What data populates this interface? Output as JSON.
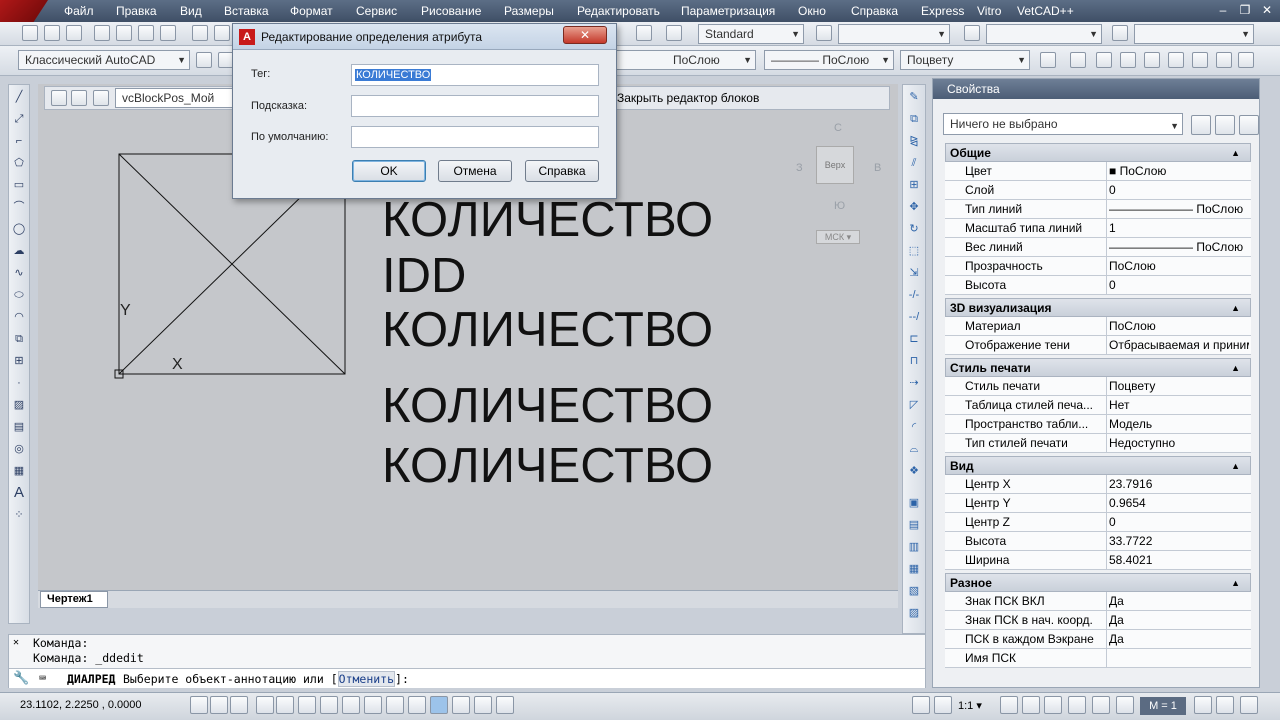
{
  "menu": {
    "items": [
      "Файл",
      "Правка",
      "Вид",
      "Вставка",
      "Формат",
      "Сервис",
      "Рисование",
      "Размеры",
      "Редактировать",
      "Параметризация",
      "Окно",
      "Справка",
      "Express",
      "Vitro",
      "VetCAD++"
    ]
  },
  "toolbar": {
    "workspace": "Классический AutoCAD",
    "text_style": "Standard",
    "linetype": "ПоСлою",
    "lineweight": "ПоСлою",
    "plotstyle": "Поцвету",
    "block_name": "vcBlockPos_Мой",
    "close_block_editor": "Закрыть редактор блоков"
  },
  "viewcube": {
    "north": "С",
    "south": "Ю",
    "west": "З",
    "east": "В",
    "face": "Верх",
    "ucs": "МСК"
  },
  "drawing": {
    "lines": [
      "КОЛИЧЕСТВО",
      "IDD",
      "КОЛИЧЕСТВО",
      "КОЛИЧЕСТВО",
      "КОЛИЧЕСТВО"
    ],
    "partial_top": "Я",
    "axis_y": "Y",
    "axis_x": "X",
    "tab": "Чертеж1"
  },
  "dialog": {
    "title": "Редактирование определения атрибута",
    "tag_label": "Тег:",
    "tag_value": "КОЛИЧЕСТВО",
    "prompt_label": "Подсказка:",
    "prompt_value": "",
    "default_label": "По умолчанию:",
    "default_value": "",
    "ok": "OK",
    "cancel": "Отмена",
    "help": "Справка"
  },
  "properties": {
    "title": "Свойства",
    "selection": "Ничего не выбрано",
    "sections": [
      {
        "name": "Общие",
        "rows": [
          [
            "Цвет",
            "ПоСлою"
          ],
          [
            "Слой",
            "0"
          ],
          [
            "Тип линий",
            "ПоСлою"
          ],
          [
            "Масштаб типа линий",
            "1"
          ],
          [
            "Вес линий",
            "ПоСлою"
          ],
          [
            "Прозрачность",
            "ПоСлою"
          ],
          [
            "Высота",
            "0"
          ]
        ]
      },
      {
        "name": "3D визуализация",
        "rows": [
          [
            "Материал",
            "ПоСлою"
          ],
          [
            "Отображение тени",
            "Отбрасываемая и приним..."
          ]
        ]
      },
      {
        "name": "Стиль печати",
        "rows": [
          [
            "Стиль печати",
            "Поцвету"
          ],
          [
            "Таблица стилей печа...",
            "Нет"
          ],
          [
            "Пространство табли...",
            "Модель"
          ],
          [
            "Тип стилей печати",
            "Недоступно"
          ]
        ]
      },
      {
        "name": "Вид",
        "rows": [
          [
            "Центр X",
            "23.7916"
          ],
          [
            "Центр Y",
            "0.9654"
          ],
          [
            "Центр Z",
            "0"
          ],
          [
            "Высота",
            "33.7722"
          ],
          [
            "Ширина",
            "58.4021"
          ]
        ]
      },
      {
        "name": "Разное",
        "rows": [
          [
            "Знак ПСК ВКЛ",
            "Да"
          ],
          [
            "Знак ПСК в нач. коорд.",
            "Да"
          ],
          [
            "ПСК в каждом Вэкране",
            "Да"
          ],
          [
            "Имя ПСК",
            ""
          ]
        ]
      }
    ]
  },
  "command": {
    "line1": "Команда:",
    "line2": "Команда: _ddedit",
    "prompt_cmd": "ДИАЛРЕД",
    "prompt_text": "Выберите объект-аннотацию или [",
    "prompt_option": "Отменить",
    "prompt_end": "]:"
  },
  "status": {
    "coords": "23.1102, 2.2250 , 0.0000",
    "scale": "1:1",
    "viewport": "M = 1"
  }
}
